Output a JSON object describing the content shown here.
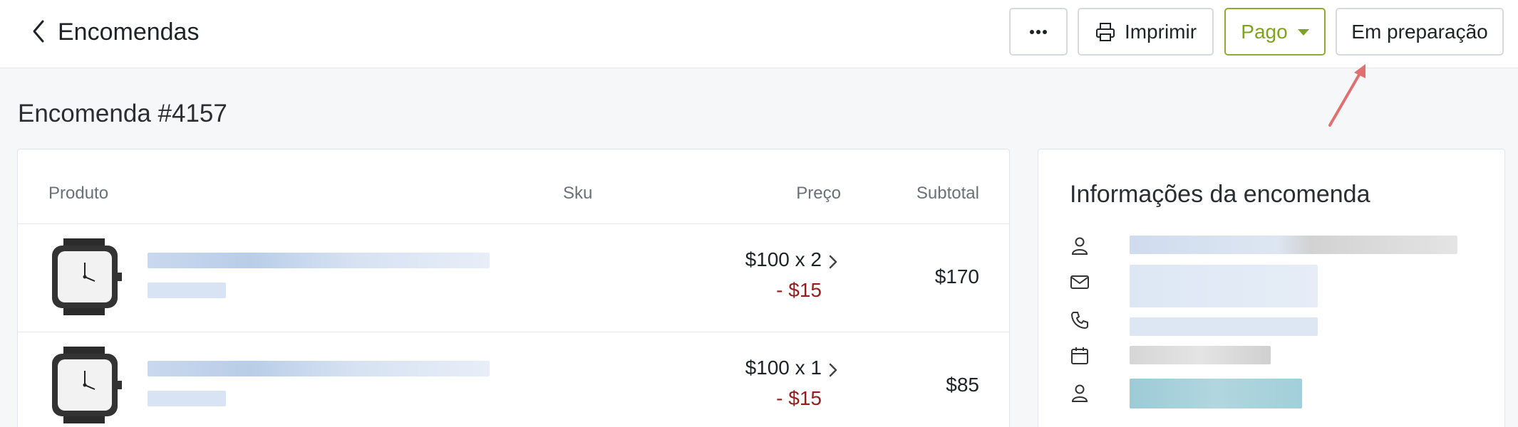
{
  "header": {
    "title": "Encomendas",
    "more_label": "···",
    "print_label": "Imprimir",
    "paid_label": "Pago",
    "status_label": "Em preparação"
  },
  "order": {
    "title": "Encomenda #4157"
  },
  "table": {
    "columns": [
      "Produto",
      "Sku",
      "Preço",
      "Subtotal"
    ],
    "rows": [
      {
        "price": "$100 x 2",
        "discount": "- $15",
        "subtotal": "$170"
      },
      {
        "price": "$100 x 1",
        "discount": "- $15",
        "subtotal": "$85"
      }
    ]
  },
  "info": {
    "title": "Informações da encomenda",
    "rows": [
      {
        "icon": "user-icon"
      },
      {
        "icon": "mail-icon"
      },
      {
        "icon": "phone-icon"
      },
      {
        "icon": "calendar-icon"
      },
      {
        "icon": "user-icon"
      }
    ]
  },
  "colors": {
    "paid_accent": "#7fa320",
    "discount": "#9b1b1b",
    "annotation_arrow": "#e07070"
  }
}
